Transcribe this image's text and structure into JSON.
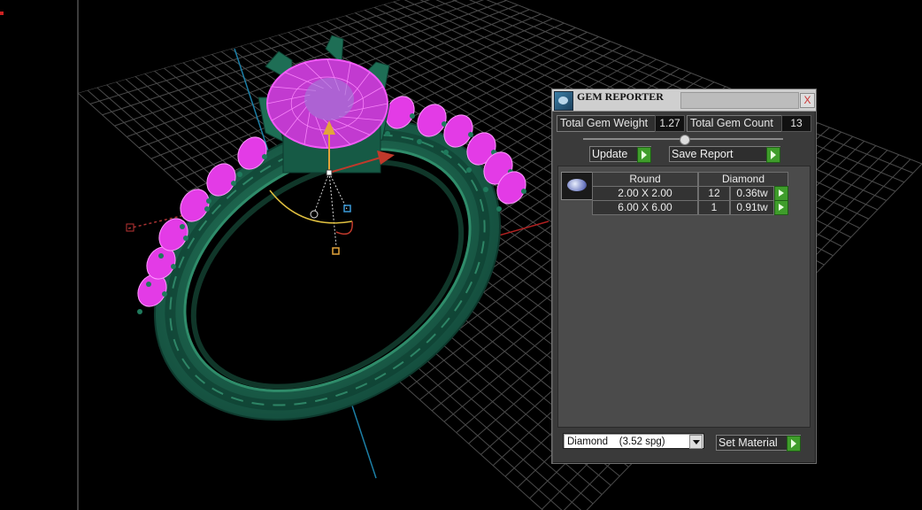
{
  "panel": {
    "title": "GEM REPORTER",
    "close_label": "X",
    "total_weight_label": "Total Gem Weight",
    "total_weight_value": "1.27",
    "total_count_label": "Total Gem Count",
    "total_count_value": "13",
    "update_label": "Update",
    "save_report_label": "Save Report",
    "table": {
      "shape_header": "Round",
      "material_header": "Diamond",
      "rows": [
        {
          "size": "2.00 X 2.00",
          "count": "12",
          "weight": "0.36tw"
        },
        {
          "size": "6.00 X 6.00",
          "count": "1",
          "weight": "0.91tw"
        }
      ]
    },
    "material_select": "Diamond    (3.52 spg)",
    "set_material_label": "Set Material"
  },
  "colors": {
    "ring": "#1f6b52",
    "gems": "#e33be6",
    "grid": "#3b3b3b",
    "go_button": "#3f9d2b"
  },
  "icons": [
    "gem-reporter-app-icon",
    "close-icon",
    "go-arrow-icon",
    "gem-thumbnail-icon",
    "dropdown-arrow-icon",
    "gizmo-move-icon"
  ]
}
